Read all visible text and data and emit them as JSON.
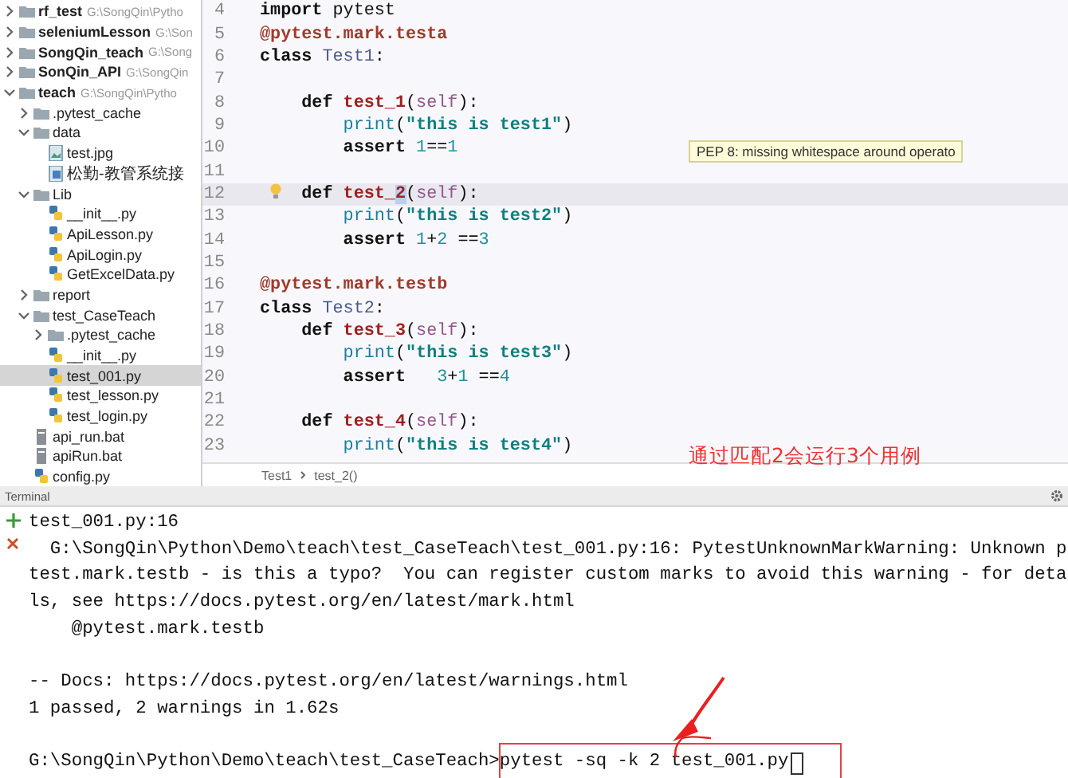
{
  "project_tree": [
    {
      "name": "rf_test",
      "path": "G:\\SongQin\\Pytho",
      "kind": "project",
      "expanded": false,
      "selected": false
    },
    {
      "name": "seleniumLesson",
      "path": "G:\\Son",
      "kind": "project",
      "expanded": false,
      "selected": false
    },
    {
      "name": "SongQin_teach",
      "path": "G:\\Song",
      "kind": "project",
      "expanded": false,
      "selected": false
    },
    {
      "name": "SonQin_API",
      "path": "G:\\SongQin",
      "kind": "project",
      "expanded": false,
      "selected": false
    },
    {
      "name": "teach",
      "path": "G:\\SongQin\\Pytho",
      "kind": "project",
      "expanded": true,
      "selected": false,
      "children": [
        {
          "name": ".pytest_cache",
          "kind": "folder",
          "expanded": false,
          "selected": false
        },
        {
          "name": "data",
          "kind": "folder",
          "expanded": true,
          "selected": false,
          "children": [
            {
              "name": "test.jpg",
              "kind": "image",
              "selected": false
            },
            {
              "name": "松勤-教管系统接",
              "kind": "sheet",
              "selected": false
            }
          ]
        },
        {
          "name": "Lib",
          "kind": "folder",
          "expanded": true,
          "selected": false,
          "children": [
            {
              "name": "__init__.py",
              "kind": "python",
              "selected": false
            },
            {
              "name": "ApiLesson.py",
              "kind": "python",
              "selected": false
            },
            {
              "name": "ApiLogin.py",
              "kind": "python",
              "selected": false
            },
            {
              "name": "GetExcelData.py",
              "kind": "python",
              "selected": false
            }
          ]
        },
        {
          "name": "report",
          "kind": "folder",
          "expanded": false,
          "selected": false
        },
        {
          "name": "test_CaseTeach",
          "kind": "folder",
          "expanded": true,
          "selected": false,
          "children": [
            {
              "name": ".pytest_cache",
              "kind": "folder",
              "expanded": false,
              "selected": false
            },
            {
              "name": "__init__.py",
              "kind": "python",
              "selected": false
            },
            {
              "name": "test_001.py",
              "kind": "python",
              "selected": true
            },
            {
              "name": "test_lesson.py",
              "kind": "python",
              "selected": false
            },
            {
              "name": "test_login.py",
              "kind": "python",
              "selected": false
            }
          ]
        },
        {
          "name": "api_run.bat",
          "kind": "bat",
          "selected": false
        },
        {
          "name": "apiRun.bat",
          "kind": "bat",
          "selected": false
        },
        {
          "name": "config.py",
          "kind": "python",
          "selected": false
        }
      ]
    }
  ],
  "editor": {
    "lines": [
      {
        "number": "4",
        "current": false,
        "tokens": [
          {
            "kind": "keyword",
            "text": "import"
          },
          {
            "kind": "plain",
            "text": " pytest"
          }
        ]
      },
      {
        "number": "5",
        "current": false,
        "tokens": [
          {
            "kind": "decorator",
            "text": "@pytest.mark.testa"
          }
        ]
      },
      {
        "number": "6",
        "current": false,
        "tokens": [
          {
            "kind": "keyword",
            "text": "class"
          },
          {
            "kind": "classname",
            "text": " Test1"
          },
          {
            "kind": "plain",
            "text": ":"
          }
        ]
      },
      {
        "number": "7",
        "current": false
      },
      {
        "number": "8",
        "current": false,
        "tokens": [
          {
            "kind": "keyword",
            "text": "    def"
          },
          {
            "kind": "funcname",
            "text": " test_1"
          },
          {
            "kind": "plain",
            "text": "("
          },
          {
            "kind": "self",
            "text": "self"
          },
          {
            "kind": "plain",
            "text": "):"
          }
        ]
      },
      {
        "number": "9",
        "current": false,
        "tokens": [
          {
            "kind": "builtin",
            "text": "        print"
          },
          {
            "kind": "plain",
            "text": "("
          },
          {
            "kind": "string",
            "text": "\"this is test1\""
          },
          {
            "kind": "plain",
            "text": ")"
          }
        ]
      },
      {
        "number": "10",
        "current": false,
        "tokens": [
          {
            "kind": "keyword",
            "text": "        assert"
          },
          {
            "kind": "number",
            "text": " 1"
          },
          {
            "kind": "plain",
            "text": "=="
          },
          {
            "kind": "number",
            "text": "1"
          }
        ]
      },
      {
        "number": "11",
        "current": false
      },
      {
        "number": "12",
        "current": true,
        "tokens": [
          {
            "kind": "keyword",
            "text": "    def"
          },
          {
            "kind": "funcname",
            "text": " test_"
          },
          {
            "kind": "selection",
            "text": "2"
          },
          {
            "kind": "plain",
            "text": "("
          },
          {
            "kind": "self",
            "text": "self"
          },
          {
            "kind": "plain",
            "text": "):"
          }
        ]
      },
      {
        "number": "13",
        "current": false,
        "tokens": [
          {
            "kind": "builtin",
            "text": "        print"
          },
          {
            "kind": "plain",
            "text": "("
          },
          {
            "kind": "string",
            "text": "\"this is test2\""
          },
          {
            "kind": "plain",
            "text": ")"
          }
        ]
      },
      {
        "number": "14",
        "current": false,
        "tokens": [
          {
            "kind": "keyword",
            "text": "        assert"
          },
          {
            "kind": "number",
            "text": " 1"
          },
          {
            "kind": "plain",
            "text": "+"
          },
          {
            "kind": "number",
            "text": "2"
          },
          {
            "kind": "plain",
            "text": " =="
          },
          {
            "kind": "number",
            "text": "3"
          }
        ]
      },
      {
        "number": "15",
        "current": false
      },
      {
        "number": "16",
        "current": false,
        "tokens": [
          {
            "kind": "decorator",
            "text": "@pytest.mark.testb"
          }
        ]
      },
      {
        "number": "17",
        "current": false,
        "tokens": [
          {
            "kind": "keyword",
            "text": "class"
          },
          {
            "kind": "classname",
            "text": " Test2"
          },
          {
            "kind": "plain",
            "text": ":"
          }
        ]
      },
      {
        "number": "18",
        "current": false,
        "tokens": [
          {
            "kind": "keyword",
            "text": "    def"
          },
          {
            "kind": "funcname",
            "text": " test_3"
          },
          {
            "kind": "plain",
            "text": "("
          },
          {
            "kind": "self",
            "text": "self"
          },
          {
            "kind": "plain",
            "text": "):"
          }
        ]
      },
      {
        "number": "19",
        "current": false,
        "tokens": [
          {
            "kind": "builtin",
            "text": "        print"
          },
          {
            "kind": "plain",
            "text": "("
          },
          {
            "kind": "string",
            "text": "\"this is test3\""
          },
          {
            "kind": "plain",
            "text": ")"
          }
        ]
      },
      {
        "number": "20",
        "current": false,
        "tokens": [
          {
            "kind": "keyword",
            "text": "        assert"
          },
          {
            "kind": "number",
            "text": "   3"
          },
          {
            "kind": "plain",
            "text": "+"
          },
          {
            "kind": "number",
            "text": "1"
          },
          {
            "kind": "plain",
            "text": " =="
          },
          {
            "kind": "number",
            "text": "4"
          }
        ]
      },
      {
        "number": "21",
        "current": false
      },
      {
        "number": "22",
        "current": false,
        "tokens": [
          {
            "kind": "keyword",
            "text": "    def"
          },
          {
            "kind": "funcname",
            "text": " test_4"
          },
          {
            "kind": "plain",
            "text": "("
          },
          {
            "kind": "self",
            "text": "self"
          },
          {
            "kind": "plain",
            "text": "):"
          }
        ]
      },
      {
        "number": "23",
        "current": false,
        "tokens": [
          {
            "kind": "builtin",
            "text": "        print"
          },
          {
            "kind": "plain",
            "text": "("
          },
          {
            "kind": "string",
            "text": "\"this is test4\""
          },
          {
            "kind": "plain",
            "text": ")"
          }
        ]
      }
    ],
    "tooltip": "PEP 8: missing whitespace around operato",
    "breadcrumb": [
      "Test1",
      "test_2()"
    ]
  },
  "terminal": {
    "title": "Terminal",
    "lines": [
      [
        "test_001.py:16",
        "  G:\\SongQin\\Python\\Demo\\teach\\test_CaseTeach\\test_001.py:16: PytestUnknownMarkWarning: Unknown p",
        "test.mark.testb - is this a typo?  You can register custom marks to avoid this warning - for deta",
        "ls, see https://docs.pytest.org/en/latest/mark.html",
        "    @pytest.mark.testb"
      ],
      [
        "-- Docs: https://docs.pytest.org/en/latest/warnings.html",
        "1 passed, 2 warnings in 1.62s"
      ]
    ],
    "prompt": "G:\\SongQin\\Python\\Demo\\teach\\test_CaseTeach>",
    "command": "pytest -sq -k 2 test_001.py"
  },
  "annotation": {
    "text": "通过匹配2会运行3个用例"
  }
}
